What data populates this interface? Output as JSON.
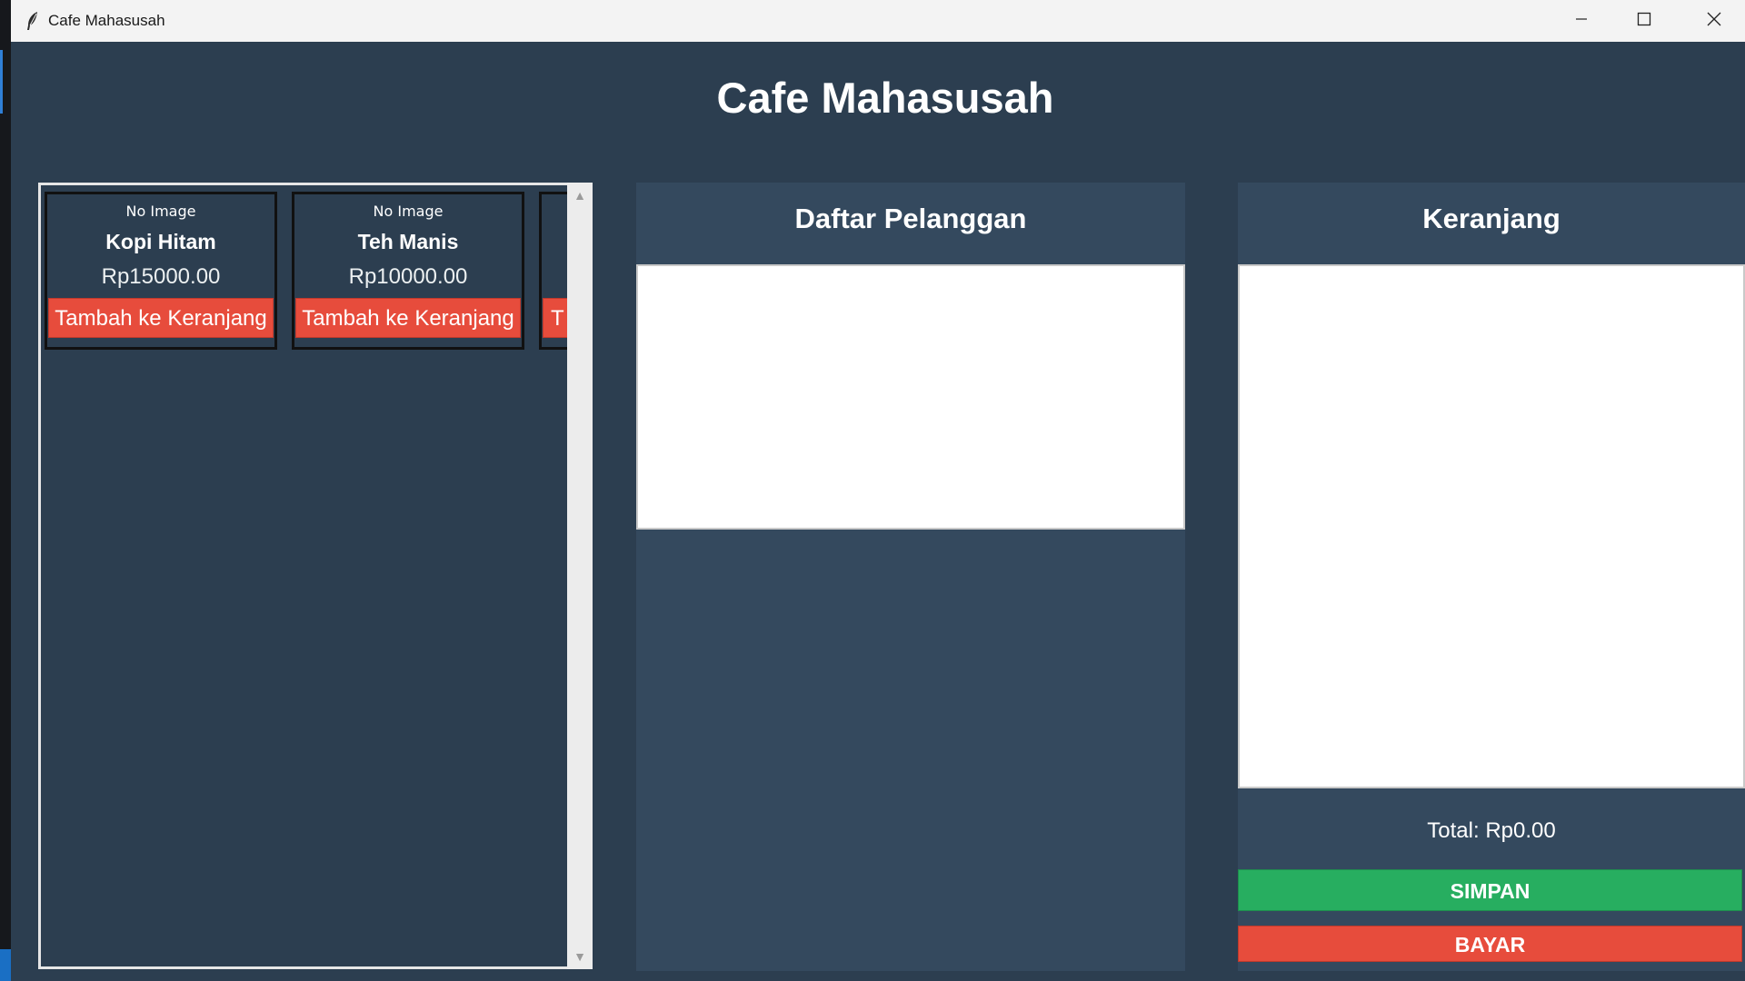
{
  "window": {
    "title": "Cafe Mahasusah"
  },
  "app": {
    "heading": "Cafe Mahasusah"
  },
  "products": [
    {
      "image_text": "No Image",
      "name": "Kopi Hitam",
      "price": "Rp15000.00",
      "button": "Tambah ke Keranjang"
    },
    {
      "image_text": "No Image",
      "name": "Teh Manis",
      "price": "Rp10000.00",
      "button": "Tambah ke Keranjang"
    },
    {
      "image_text": "",
      "name": "",
      "price": "",
      "button": "T"
    }
  ],
  "customers": {
    "title": "Daftar Pelanggan",
    "items": []
  },
  "cart": {
    "title": "Keranjang",
    "items": [],
    "total": "Total: Rp0.00",
    "save_label": "SIMPAN",
    "pay_label": "BAYAR"
  },
  "colors": {
    "background": "#2c3e50",
    "panel": "#34495e",
    "danger_button": "#e74c3c",
    "success_button": "#27ae60"
  },
  "icons": {
    "app": "feather-icon",
    "minimize": "minimize-icon",
    "maximize": "maximize-icon",
    "close": "close-icon"
  }
}
